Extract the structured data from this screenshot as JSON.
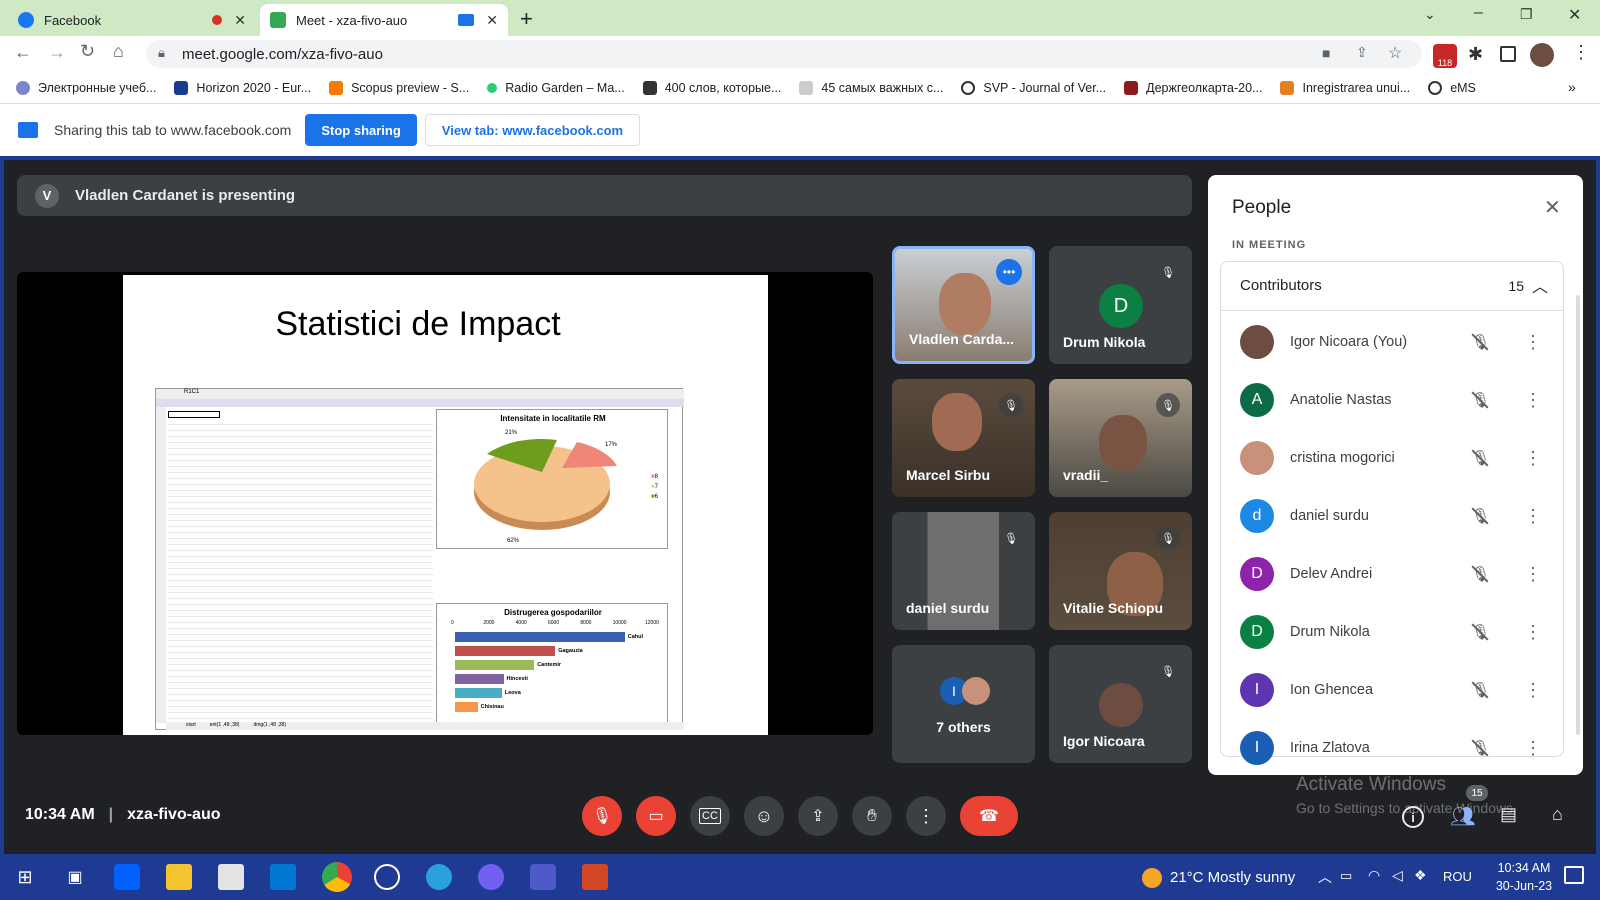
{
  "browser": {
    "tabs": [
      {
        "title": "Facebook",
        "color": "#1877f2"
      },
      {
        "title": "Meet - xza-fivo-auo",
        "color": "#34a853"
      }
    ],
    "url": "meet.google.com/xza-fivo-auo",
    "ext_badge": "118",
    "bookmarks": [
      "Электронные учеб...",
      "Horizon 2020 - Eur...",
      "Scopus preview - S...",
      "Radio Garden – Ma...",
      "400 слов, которые...",
      "45 самых важных с...",
      "SVP - Journal of Ver...",
      "Держгеолкарта-20...",
      "Inregistrarea unui...",
      "eMS"
    ],
    "bookmarks_more": "»"
  },
  "share_bar": {
    "text": "Sharing this tab to www.facebook.com",
    "stop": "Stop sharing",
    "view": "View tab: www.facebook.com"
  },
  "meet": {
    "presenter_initial": "V",
    "presenting": "Vladlen Cardanet is presenting",
    "slide_title": "Statistici de Impact",
    "pie_title": "Intensitate in localitatile RM",
    "pie_labels": [
      "21%",
      "17%",
      "62%"
    ],
    "pie_legend": [
      "8",
      "7",
      "6"
    ],
    "bar_title": "Distrugerea gospodariilor",
    "bar_axis": [
      "0",
      "2000",
      "4000",
      "6000",
      "8000",
      "10000",
      "12000"
    ],
    "bar_labels": [
      "Cahul",
      "Gagauzia",
      "Cantemir",
      "Hincesti",
      "Leova",
      "Chisinau"
    ],
    "bar_values": [
      10500,
      6200,
      4900,
      3000,
      2900,
      1400
    ],
    "sheet_cell": "R1C1",
    "sheet_tabs": [
      "start",
      "ent(1 ,48 ,38)",
      "dmg(1 ,48 ,38)"
    ],
    "tiles": [
      {
        "name": "Vladlen Carda...",
        "initial": ""
      },
      {
        "name": "Drum Nikola",
        "initial": "D"
      },
      {
        "name": "Marcel Sirbu",
        "initial": ""
      },
      {
        "name": "vradii_",
        "initial": ""
      },
      {
        "name": "daniel surdu",
        "initial": ""
      },
      {
        "name": "Vitalie Schiopu",
        "initial": ""
      },
      {
        "name": "7 others",
        "initial": "I"
      },
      {
        "name": "Igor Nicoara",
        "initial": ""
      }
    ],
    "time": "10:34 AM",
    "code": "xza-fivo-auo",
    "people_badge": "15"
  },
  "people": {
    "title": "People",
    "section": "IN MEETING",
    "group": "Contributors",
    "count": "15",
    "list": [
      {
        "name": "Igor Nicoara (You)",
        "initial": "",
        "color": "#6d4c41"
      },
      {
        "name": "Anatolie Nastas",
        "initial": "A",
        "color": "#0b6b45"
      },
      {
        "name": "cristina mogorici",
        "initial": "",
        "color": "#c9917a"
      },
      {
        "name": "daniel surdu",
        "initial": "d",
        "color": "#1e88e5"
      },
      {
        "name": "Delev Andrei",
        "initial": "D",
        "color": "#8e24aa"
      },
      {
        "name": "Drum Nikola",
        "initial": "D",
        "color": "#0b8043"
      },
      {
        "name": "Ion Ghencea",
        "initial": "I",
        "color": "#5e35b1"
      },
      {
        "name": "Irina Zlatova",
        "initial": "I",
        "color": "#1a5fb4"
      }
    ]
  },
  "watermark": {
    "line1": "Activate Windows",
    "line2": "Go to Settings to activate Windows."
  },
  "taskbar": {
    "weather": "21°C  Mostly sunny",
    "lang": "ROU",
    "time": "10:34 AM",
    "date": "30-Jun-23"
  }
}
